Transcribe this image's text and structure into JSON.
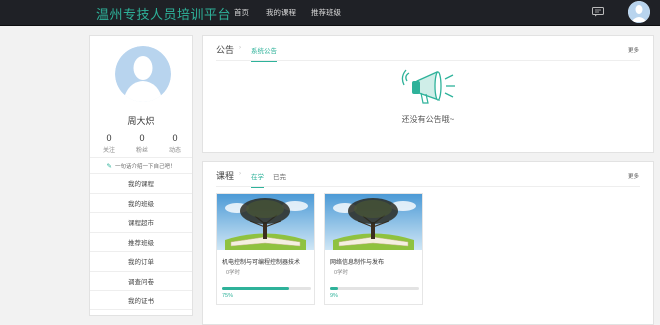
{
  "header": {
    "brand": "温州专技人员培训平台",
    "nav": [
      "首页",
      "我的课程",
      "推荐班级"
    ]
  },
  "profile": {
    "name": "周大炽",
    "stats": [
      {
        "value": "0",
        "label": "关注"
      },
      {
        "value": "0",
        "label": "粉丝"
      },
      {
        "value": "0",
        "label": "动态"
      }
    ],
    "intro": "一句话介绍一下自己吧！",
    "menu": [
      "我的课程",
      "我的班级",
      "课程超市",
      "推荐班级",
      "我的订单",
      "调查问卷",
      "我的证书"
    ]
  },
  "announcements": {
    "title": "公告",
    "tab": "系统公告",
    "more": "更多",
    "empty": "还没有公告哦~"
  },
  "courses": {
    "title": "课程",
    "tabs": [
      "在学",
      "已完"
    ],
    "more": "更多",
    "items": [
      {
        "title": "机电控制与可编程控制器技术",
        "hours": "0学时",
        "progress_pct": 75,
        "progress_label": "75%"
      },
      {
        "title": "网络信息制作与发布",
        "hours": "0学时",
        "progress_pct": 9,
        "progress_label": "9%"
      }
    ]
  },
  "colors": {
    "accent": "#2eb29a",
    "topbar": "#1f2126",
    "avatar_bg": "#b8d4ee"
  },
  "icons": {
    "message": "message-icon",
    "megaphone": "megaphone-icon",
    "edit": "pencil-icon",
    "chevron": "chevron-right-icon"
  }
}
